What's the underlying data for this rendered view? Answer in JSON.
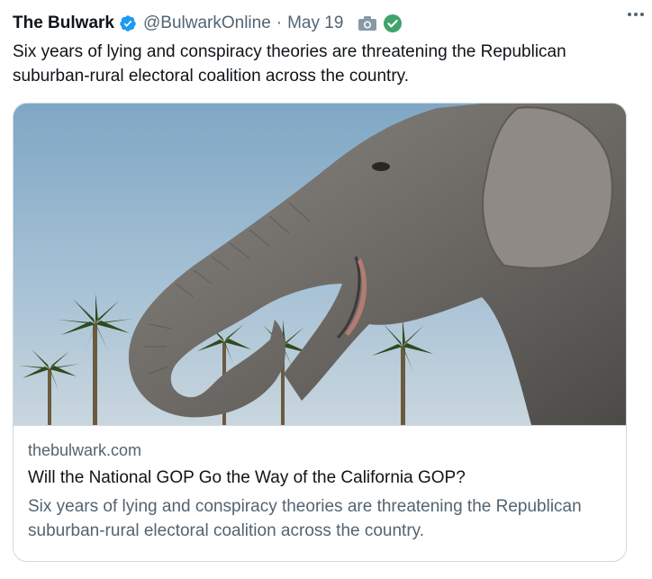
{
  "tweet": {
    "author_name": "The Bulwark",
    "handle": "@BulwarkOnline",
    "separator": "·",
    "date": "May 19",
    "text": "Six years of lying and conspiracy theories are threatening the Republican suburban-rural electoral coalition across the country.",
    "more_icon": "more-horizontal-icon",
    "verified_icon": "verified-badge-icon",
    "media_icon": "camera-icon",
    "check_icon": "checkmark-circle-icon"
  },
  "card": {
    "domain": "thebulwark.com",
    "title": "Will the National GOP Go the Way of the California GOP?",
    "description": "Six years of lying and conspiracy theories are threatening the Republican suburban-rural electoral coalition across the country.",
    "image_subject": "elephant-with-palm-trees"
  },
  "colors": {
    "verified_blue": "#1d9bf0",
    "check_green": "#41a36b",
    "secondary_text": "#536471",
    "border": "#cfd9de"
  }
}
